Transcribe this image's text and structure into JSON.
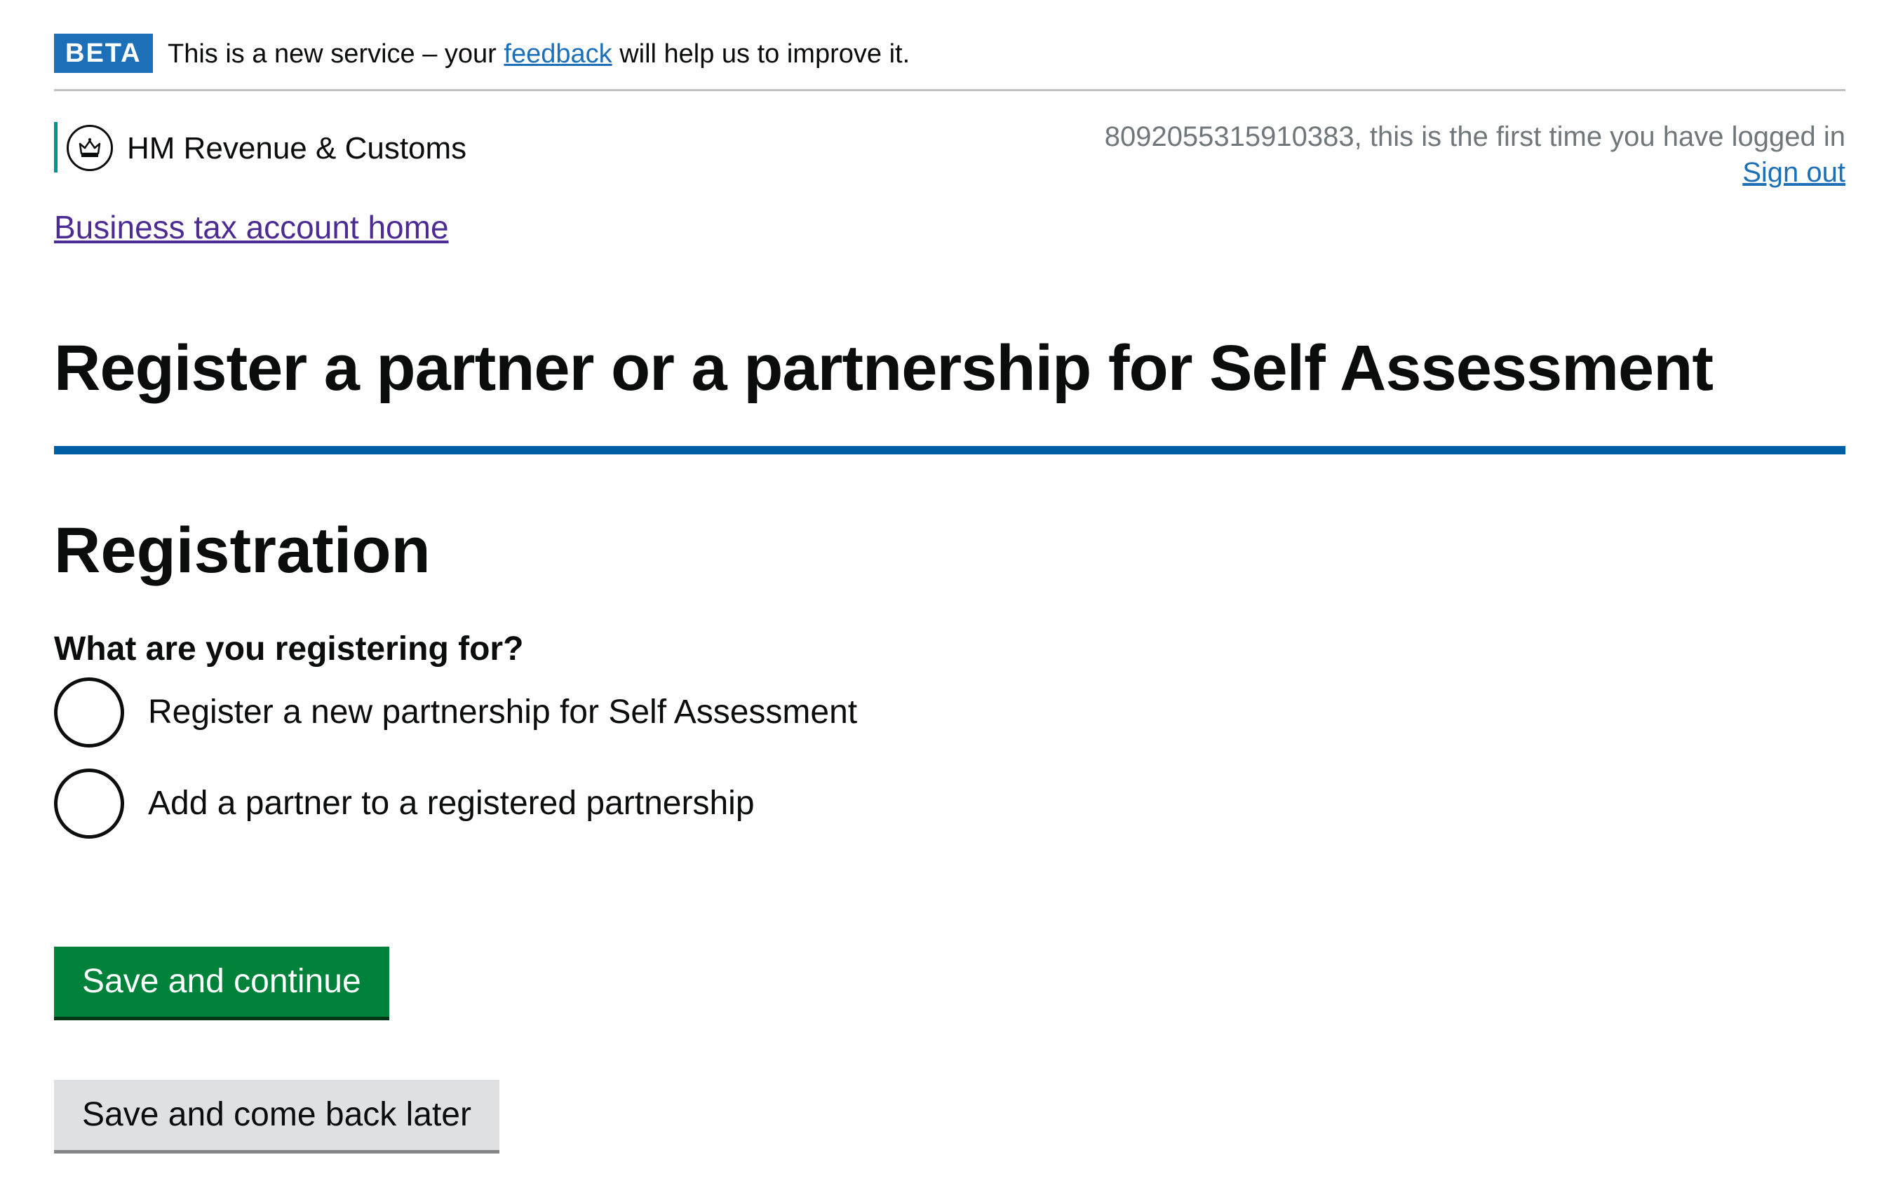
{
  "beta_banner": {
    "tag": "BETA",
    "text_before": "This is a new service – your ",
    "link_text": "feedback",
    "text_after": " will help us to improve it."
  },
  "header": {
    "org_name": "HM Revenue & Customs",
    "crest_icon": "crown-crest-icon",
    "user_status": "8092055315910383, this is the first time you have logged in",
    "sign_out": "Sign out"
  },
  "nav": {
    "home_link": "Business tax account home"
  },
  "main": {
    "service_title": "Register a partner or a partnership for Self Assessment",
    "heading": "Registration",
    "question": "What are you registering for?",
    "options": [
      {
        "label": "Register a new partnership for Self Assessment",
        "checked": false
      },
      {
        "label": "Add a partner to a registered partnership",
        "checked": false
      }
    ],
    "primary_button": "Save and continue",
    "secondary_button": "Save and come back later"
  },
  "colors": {
    "beta_tag": "#1d70b8",
    "link": "#1d70b8",
    "visited_link": "#4c2c92",
    "org_accent": "#009390",
    "title_rule": "#005ea5",
    "primary_button": "#00823b",
    "secondary_button": "#dee0e2"
  }
}
